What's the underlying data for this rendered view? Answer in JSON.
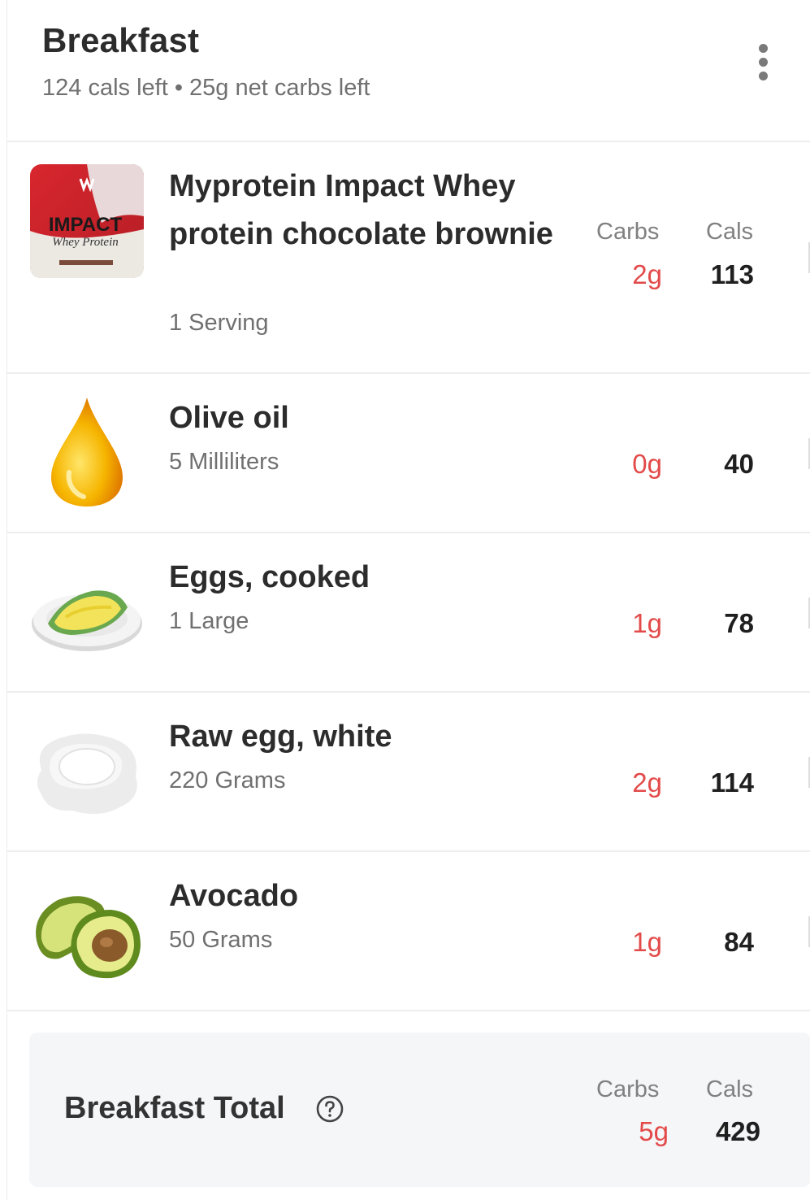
{
  "header": {
    "title": "Breakfast",
    "summary": "124 cals left • 25g net carbs left",
    "menu_icon": "more-vertical-icon"
  },
  "columns": {
    "carbs": "Carbs",
    "cals": "Cals"
  },
  "entries": [
    {
      "name": "Myprotein Impact Whey protein chocolate brownie",
      "quantity": "1 Serving",
      "carbs": "2g",
      "cals": "113",
      "image": "protein-pouch-icon",
      "image_text": [
        "IMPACT",
        "Whey Protein"
      ]
    },
    {
      "name": "Olive oil",
      "quantity": "5 Milliliters",
      "carbs": "0g",
      "cals": "40",
      "image": "oil-drop-icon"
    },
    {
      "name": "Eggs, cooked",
      "quantity": "1 Large",
      "carbs": "1g",
      "cals": "78",
      "image": "omelette-plate-icon"
    },
    {
      "name": "Raw egg, white",
      "quantity": "220 Grams",
      "carbs": "2g",
      "cals": "114",
      "image": "egg-white-icon"
    },
    {
      "name": "Avocado",
      "quantity": "50 Grams",
      "carbs": "1g",
      "cals": "84",
      "image": "avocado-icon"
    }
  ],
  "total": {
    "label": "Breakfast Total",
    "carbs": "5g",
    "cals": "429",
    "help_icon": "help-circle-icon"
  },
  "colors": {
    "carbs": "#e34a4a",
    "text": "#2c2c2c",
    "muted": "#707070",
    "total_bg": "#f5f6f8"
  }
}
